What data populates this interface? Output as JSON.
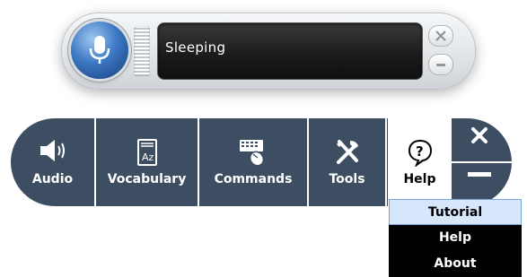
{
  "speech_widget": {
    "status": "Sleeping",
    "icons": {
      "mic": "microphone-icon",
      "close": "close-icon",
      "minimize": "minimize-icon"
    }
  },
  "toolbar": {
    "items": [
      {
        "label": "Audio",
        "icon": "speaker-icon"
      },
      {
        "label": "Vocabulary",
        "icon": "vocabulary-book-icon"
      },
      {
        "label": "Commands",
        "icon": "keyboard-mouse-icon"
      },
      {
        "label": "Tools",
        "icon": "tools-icon"
      },
      {
        "label": "Help",
        "icon": "help-bubble-icon"
      }
    ],
    "close_icon": "close-icon",
    "minimize_icon": "minimize-icon"
  },
  "help_menu": {
    "items": [
      {
        "label": "Tutorial",
        "highlighted": true
      },
      {
        "label": "Help",
        "highlighted": false
      },
      {
        "label": "About",
        "highlighted": false
      }
    ]
  },
  "colors": {
    "toolbar_bg": "#3d4e63",
    "mic_blue": "#3d78c4",
    "menu_bg": "#000000",
    "menu_highlight": "#d7e7fb"
  }
}
